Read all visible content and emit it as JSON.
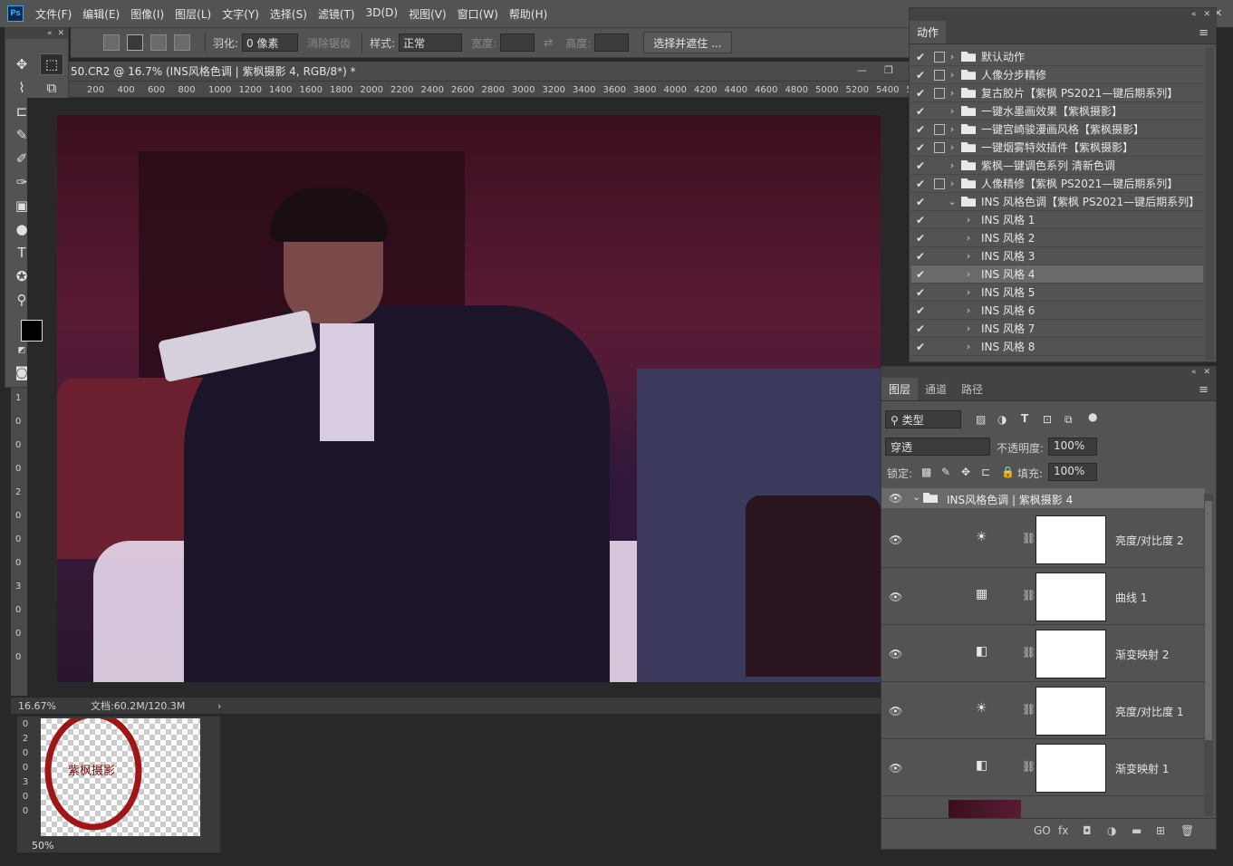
{
  "app": {
    "logo": "Ps"
  },
  "menu": [
    "文件(F)",
    "编辑(E)",
    "图像(I)",
    "图层(L)",
    "文字(Y)",
    "选择(S)",
    "滤镜(T)",
    "3D(D)",
    "视图(V)",
    "窗口(W)",
    "帮助(H)"
  ],
  "window_controls": {
    "minimize": "—",
    "restore": "❐",
    "close": "✕"
  },
  "options": {
    "feather_label": "羽化:",
    "feather_value": "0 像素",
    "antialias_label": "消除锯齿",
    "style_label": "样式:",
    "style_value": "正常",
    "width_label": "宽度:",
    "height_label": "高度:",
    "select_mask_button": "选择并遮住 ..."
  },
  "document": {
    "tab_title": "50.CR2 @ 16.7% (INS风格色调 | 紫枫摄影  4, RGB/8*) *",
    "ruler_ticks": [
      "200",
      "400",
      "600",
      "800",
      "1000",
      "1200",
      "1400",
      "1600",
      "1800",
      "2000",
      "2200",
      "2400",
      "2600",
      "2800",
      "3000",
      "3200",
      "3400",
      "3600",
      "3800",
      "4000",
      "4200",
      "4400",
      "4600",
      "4800",
      "5000",
      "5200",
      "5400",
      "5"
    ],
    "vruler_ticks": [
      "1",
      "0",
      "0",
      "0",
      "2",
      "0",
      "0",
      "0",
      "3",
      "0",
      "0",
      "0"
    ],
    "zoom": "16.67%",
    "doc_size": "文档:60.2M/120.3M",
    "status_arrow": "›"
  },
  "navigator": {
    "zoom": "50%",
    "ruler_ticks": [
      "0",
      "2",
      "0",
      "0",
      "3",
      "0",
      "0"
    ],
    "watermark": "紫枫摄影"
  },
  "actions_panel": {
    "tab": "动作",
    "menu_icon": "≡",
    "rows": [
      {
        "check": "✔",
        "dialog": true,
        "arrow": "›",
        "folder": true,
        "name": "默认动作"
      },
      {
        "check": "✔",
        "dialog": true,
        "arrow": "›",
        "folder": true,
        "name": "人像分步精修"
      },
      {
        "check": "✔",
        "dialog": true,
        "arrow": "›",
        "folder": true,
        "name": "复古胶片【紫枫 PS2021—键后期系列】"
      },
      {
        "check": "✔",
        "dialog": false,
        "arrow": "›",
        "folder": true,
        "name": "一键水墨画效果【紫枫摄影】"
      },
      {
        "check": "✔",
        "dialog": true,
        "arrow": "›",
        "folder": true,
        "name": "一键宫崎骏漫画风格【紫枫摄影】"
      },
      {
        "check": "✔",
        "dialog": true,
        "arrow": "›",
        "folder": true,
        "name": "一键烟雾特效插件【紫枫摄影】"
      },
      {
        "check": "✔",
        "dialog": false,
        "arrow": "›",
        "folder": true,
        "name": "紫枫—键调色系列 清新色调"
      },
      {
        "check": "✔",
        "dialog": true,
        "arrow": "›",
        "folder": true,
        "name": "人像精修【紫枫 PS2021—键后期系列】"
      },
      {
        "check": "✔",
        "dialog": false,
        "arrow": "⌄",
        "folder": true,
        "name": "INS 风格色调【紫枫 PS2021—键后期系列】"
      },
      {
        "check": "✔",
        "dialog": false,
        "arrow": "›",
        "folder": false,
        "name": "INS 风格  1",
        "indent": true
      },
      {
        "check": "✔",
        "dialog": false,
        "arrow": "›",
        "folder": false,
        "name": "INS 风格  2",
        "indent": true
      },
      {
        "check": "✔",
        "dialog": false,
        "arrow": "›",
        "folder": false,
        "name": "INS 风格  3",
        "indent": true
      },
      {
        "check": "✔",
        "dialog": false,
        "arrow": "›",
        "folder": false,
        "name": "INS 风格  4",
        "indent": true,
        "selected": true
      },
      {
        "check": "✔",
        "dialog": false,
        "arrow": "›",
        "folder": false,
        "name": "INS 风格  5",
        "indent": true
      },
      {
        "check": "✔",
        "dialog": false,
        "arrow": "›",
        "folder": false,
        "name": "INS 风格  6",
        "indent": true
      },
      {
        "check": "✔",
        "dialog": false,
        "arrow": "›",
        "folder": false,
        "name": "INS 风格  7",
        "indent": true
      },
      {
        "check": "✔",
        "dialog": false,
        "arrow": "›",
        "folder": false,
        "name": "INS 风格  8",
        "indent": true
      }
    ]
  },
  "layers_panel": {
    "tabs": [
      "图层",
      "通道",
      "路径"
    ],
    "menu_icon": "≡",
    "filter_value": "类型",
    "blend_mode": "穿透",
    "opacity_label": "不透明度:",
    "opacity_value": "100%",
    "lock_label": "锁定:",
    "fill_label": "填充:",
    "fill_value": "100%",
    "group_name": "INS风格色调 | 紫枫摄影  4",
    "layers": [
      {
        "icon": "☀",
        "icon_name": "brightness-icon",
        "name": "亮度/对比度  2"
      },
      {
        "icon": "▦",
        "icon_name": "curves-icon",
        "name": "曲线  1"
      },
      {
        "icon": "◧",
        "icon_name": "gradient-map-icon",
        "name": "渐变映射  2"
      },
      {
        "icon": "☀",
        "icon_name": "brightness-icon",
        "name": "亮度/对比度  1"
      },
      {
        "icon": "◧",
        "icon_name": "gradient-map-icon",
        "name": "渐变映射  1"
      }
    ],
    "footer_icons": [
      "GO",
      "fx",
      "◘",
      "◑",
      "▬",
      "⊞",
      "🗑"
    ]
  },
  "colors": {
    "panel": "#535353",
    "dark": "#282828",
    "accent": "#31a8ff"
  }
}
